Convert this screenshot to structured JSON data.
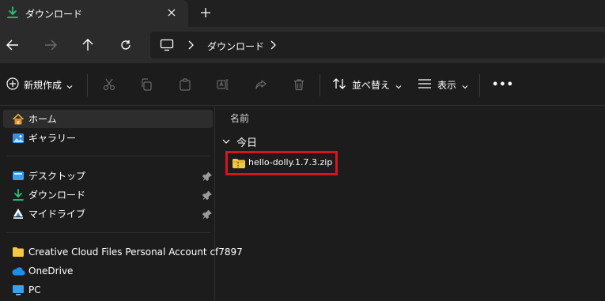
{
  "tab": {
    "title": "ダウンロード",
    "close_icon": "close-icon",
    "new_tab_icon": "plus-icon"
  },
  "address": {
    "breadcrumb": "ダウンロード"
  },
  "toolbar": {
    "new_label": "新規作成",
    "sort_label": "並べ替え",
    "view_label": "表示",
    "more_label": "•••"
  },
  "sidebar": {
    "items": [
      {
        "label": "ホーム",
        "icon": "home-icon"
      },
      {
        "label": "ギャラリー",
        "icon": "gallery-icon"
      },
      {
        "label": "デスクトップ",
        "icon": "desktop-icon"
      },
      {
        "label": "ダウンロード",
        "icon": "download-icon"
      },
      {
        "label": "マイドライブ",
        "icon": "drive-icon"
      },
      {
        "label": "Creative Cloud Files Personal Account cf7897",
        "icon": "folder-icon"
      },
      {
        "label": "OneDrive",
        "icon": "cloud-icon"
      },
      {
        "label": "PC",
        "icon": "pc-icon"
      }
    ]
  },
  "main": {
    "column_name": "名前",
    "group_label": "今日",
    "files": [
      {
        "name": "hello-dolly.1.7.3.zip",
        "icon": "zip-folder-icon"
      }
    ]
  },
  "colors": {
    "accent": "#0ea16b",
    "highlight_border": "#d8141f",
    "folder": "#f2c744"
  }
}
